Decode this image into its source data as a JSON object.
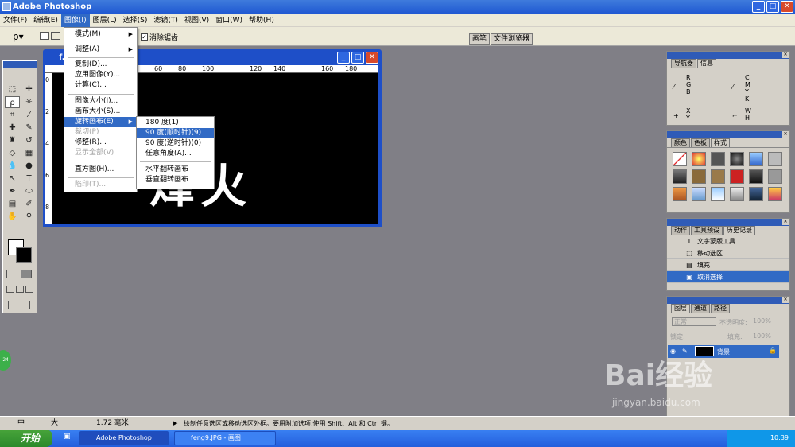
{
  "app": {
    "title": "Adobe Photoshop"
  },
  "menubar": [
    "文件(F)",
    "编辑(E)",
    "图像(I)",
    "图层(L)",
    "选择(S)",
    "滤镜(T)",
    "视图(V)",
    "窗口(W)",
    "帮助(H)"
  ],
  "options_bar": {
    "antialias_label": "消除锯齿",
    "antialias_checked": "✓",
    "tabs": [
      "画笔",
      "文件浏览器"
    ]
  },
  "document": {
    "title": "f... (GB)",
    "ruler_top": [
      "60",
      "80",
      "100",
      "120",
      "140",
      "160",
      "180"
    ],
    "ruler_left": [
      "0",
      "2",
      "4",
      "6",
      "8"
    ],
    "canvas_text": "烽火",
    "canvas_bg": "#000000"
  },
  "image_menu": {
    "items": [
      {
        "label": "模式(M)",
        "arrow": "▶"
      },
      {
        "label": "调整(A)",
        "arrow": "▶"
      },
      {
        "label": "复制(D)..."
      },
      {
        "label": "应用图像(Y)..."
      },
      {
        "label": "计算(C)..."
      },
      {
        "label": "图像大小(I)..."
      },
      {
        "label": "画布大小(S)..."
      },
      {
        "label": "旋转画布(E)",
        "arrow": "▶"
      },
      {
        "label": "裁切(P)"
      },
      {
        "label": "修整(R)..."
      },
      {
        "label": "显示全部(V)"
      },
      {
        "label": "直方图(H)..."
      },
      {
        "label": "陷印(T)..."
      }
    ]
  },
  "rotate_submenu": {
    "items": [
      "180 度(1)",
      "90 度(顺时针)(9)",
      "90 度(逆时针)(0)",
      "任意角度(A)...",
      "水平翻转画布",
      "垂直翻转画布"
    ]
  },
  "panels": {
    "navigator": {
      "tabs": [
        "导航器",
        "信息"
      ],
      "labels": {
        "rgb": "R\nG\nB",
        "cmyk": "C\nM\nY\nK",
        "xy": "X\nY",
        "wh": "W\nH"
      }
    },
    "color": {
      "tabs": [
        "颜色",
        "色板",
        "样式"
      ]
    },
    "history": {
      "tabs": [
        "动作",
        "工具预设",
        "历史记录"
      ],
      "items": [
        "文字蒙版工具",
        "移动选区",
        "填充",
        "取消选择"
      ]
    },
    "layers": {
      "tabs": [
        "图层",
        "通道",
        "路径"
      ],
      "mode": "正常",
      "opacity_label": "不透明度:",
      "opacity": "100%",
      "lock_label": "锁定:",
      "fill_label": "填充:",
      "fill": "100%",
      "layer_name": "背景"
    }
  },
  "status": {
    "zoom": "1.72 毫米",
    "ime": "中",
    "ime_punct": "大",
    "hint": "绘制任意选区或移动选区外框。要用附加选项,使用 Shift、Alt 和 Ctrl 键。"
  },
  "taskbar": {
    "start": "开始",
    "tasks": [
      "Adobe Photoshop",
      "feng9.JPG - 画图"
    ],
    "clock": "10:39"
  },
  "watermark": {
    "text": "Bai经验",
    "sub": "jingyan.baidu.com"
  },
  "badge": "24"
}
